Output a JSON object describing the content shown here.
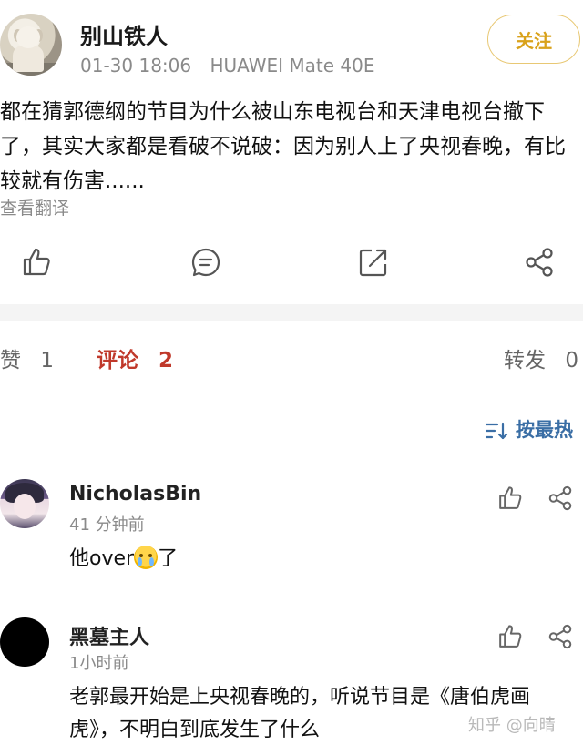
{
  "post": {
    "author": "别山铁人",
    "date": "01-30 18:06",
    "device": "HUAWEI Mate 40E",
    "follow_label": "关注",
    "content": "都在猜郭德纲的节目为什么被山东电视台和天津电视台撤下了，其实大家都是看破不说破：因为别人上了央视春晚，有比较就有伤害......",
    "translate_label": "查看翻译"
  },
  "actions": {
    "icons": [
      "like-icon",
      "comment-icon",
      "repost-icon",
      "share-icon"
    ]
  },
  "stats": {
    "likes_label": "赞",
    "likes_count": "1",
    "comments_label": "评论",
    "comments_count": "2",
    "reposts_label": "转发",
    "reposts_count": "0"
  },
  "sort": {
    "label": "按最热"
  },
  "comments": [
    {
      "user": "NicholasBin",
      "time": "41 分钟前",
      "text_before": "他over",
      "emoji": "crying-face-emoji",
      "text_after": "了"
    },
    {
      "user": "黑墓主人",
      "time": "1小时前",
      "text": "老郭最开始是上央视春晚的，听说节目是《唐伯虎画虎》，不明白到底发生了什么"
    }
  ],
  "watermark": "知乎 @向晴",
  "colors": {
    "follow_border": "#e8c874",
    "follow_text": "#d9a21b",
    "active_tab": "#c0392b",
    "sort_link": "#3a6ea5"
  }
}
